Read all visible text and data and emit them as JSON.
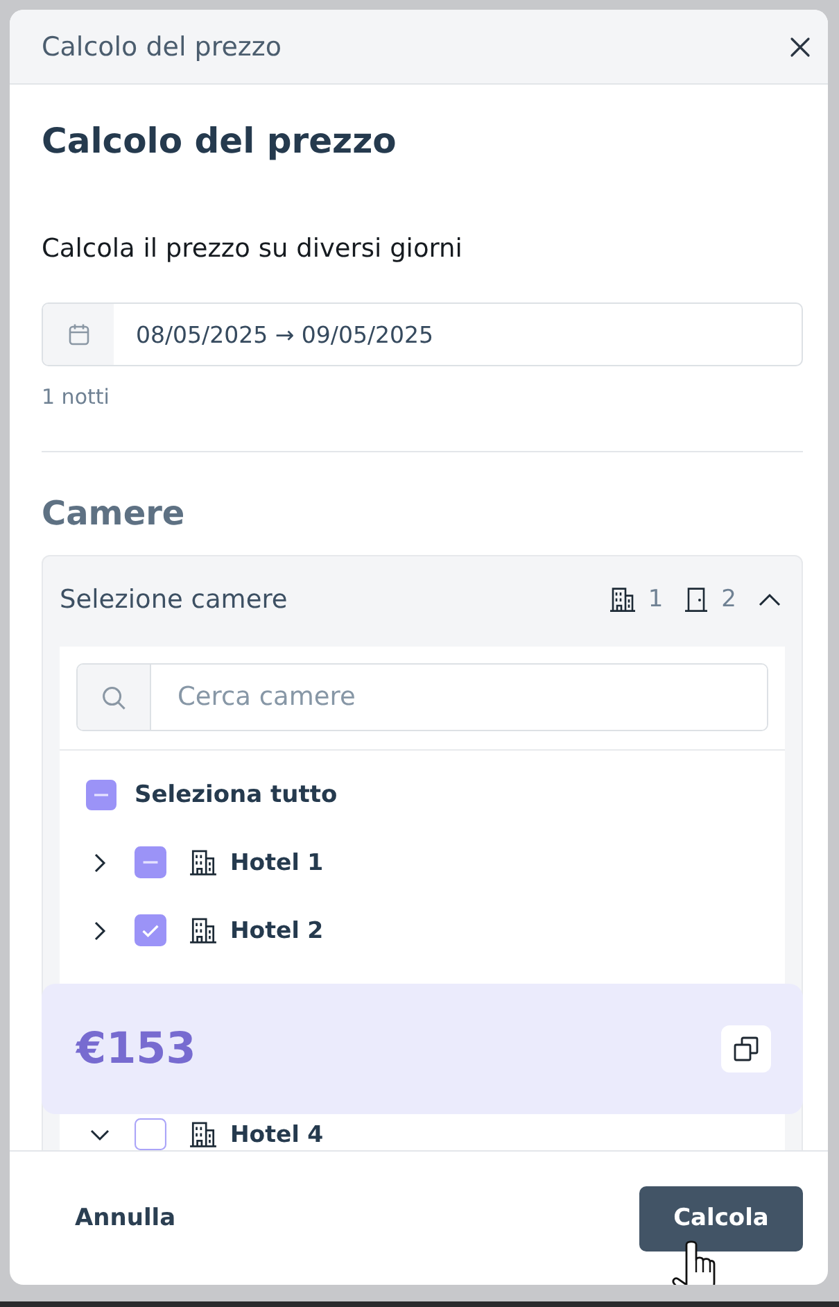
{
  "dialog": {
    "title": "Calcolo del prezzo",
    "heading": "Calcolo del prezzo"
  },
  "dates": {
    "description": "Calcola il prezzo su diversi giorni",
    "value": "08/05/2025 → 09/05/2025",
    "nights": "1 notti"
  },
  "rooms": {
    "title": "Camere",
    "panel_title": "Selezione camere",
    "expanded": true,
    "counts": [
      {
        "kind": "hotel",
        "value": "1"
      },
      {
        "kind": "room",
        "value": "2"
      }
    ],
    "search": {
      "placeholder": "Cerca camere"
    },
    "select_all": {
      "label": "Seleziona tutto",
      "checked": false,
      "indeterminate": true
    },
    "hotels": [
      {
        "label": "Hotel 1",
        "expanded": false,
        "checked": false,
        "indeterminate": true
      },
      {
        "label": "Hotel 2",
        "expanded": false,
        "checked": true,
        "indeterminate": false
      },
      {
        "label": "Hotel 4",
        "expanded": true,
        "checked": false,
        "indeterminate": false
      }
    ]
  },
  "price": {
    "value": "€153"
  },
  "footer": {
    "buttons": [
      {
        "kind": "secondary",
        "label": "Annulla"
      },
      {
        "kind": "primary",
        "label": "Calcola"
      }
    ]
  }
}
